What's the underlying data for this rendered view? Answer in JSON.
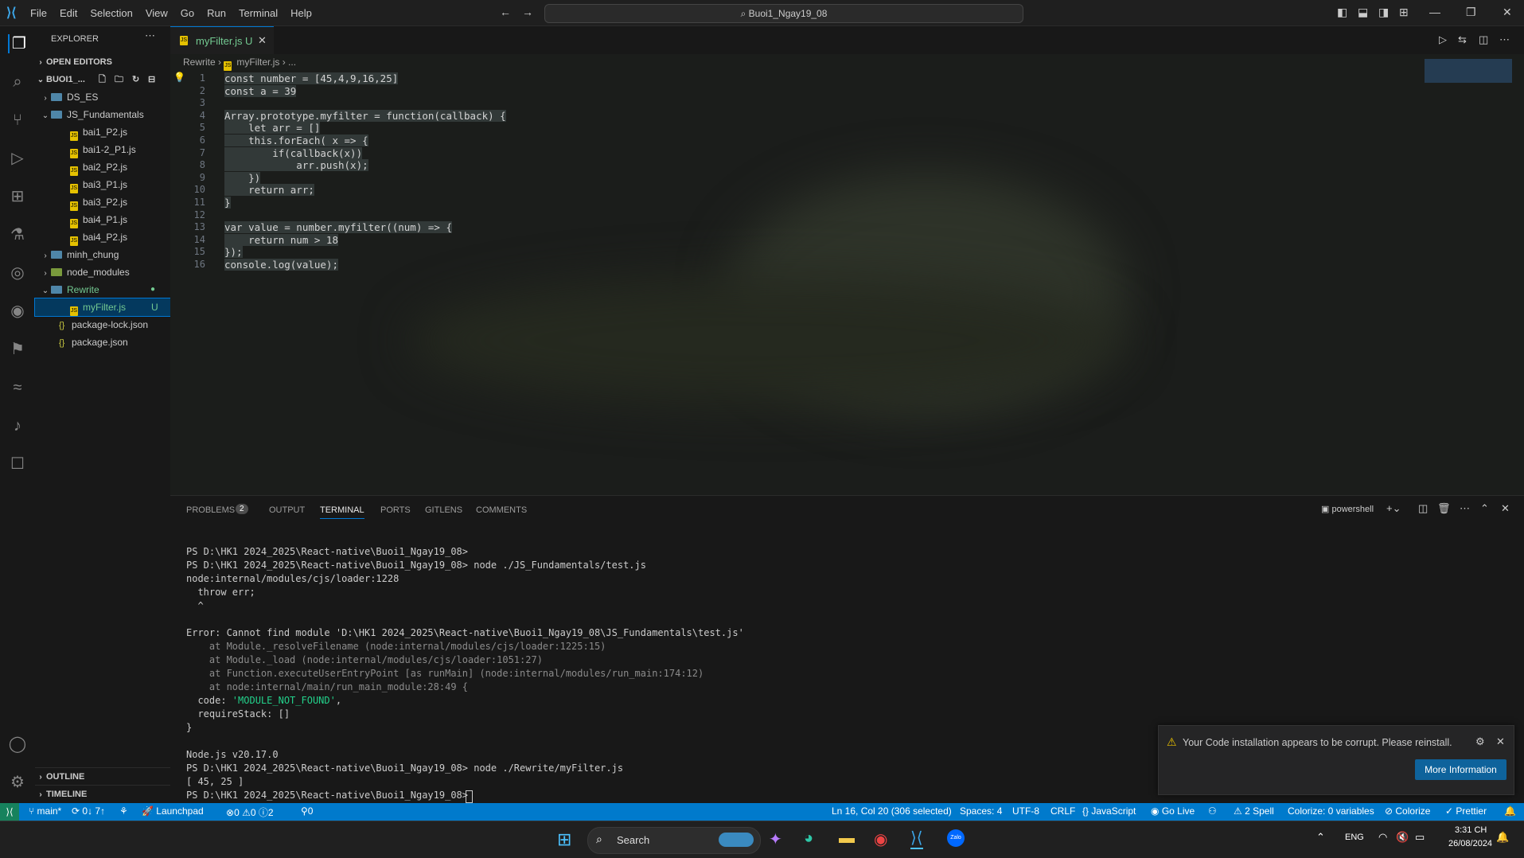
{
  "menu": [
    "File",
    "Edit",
    "Selection",
    "View",
    "Go",
    "Run",
    "Terminal",
    "Help"
  ],
  "command_center": "Buoi1_Ngay19_08",
  "explorer": {
    "title": "EXPLORER",
    "open_editors": "OPEN EDITORS",
    "workspace": "BUOI1_...",
    "items": [
      {
        "label": "DS_ES",
        "type": "folder",
        "depth": 1
      },
      {
        "label": "JS_Fundamentals",
        "type": "folder-open",
        "depth": 1
      },
      {
        "label": "bai1_P2.js",
        "type": "js",
        "depth": 2
      },
      {
        "label": "bai1-2_P1.js",
        "type": "js",
        "depth": 2
      },
      {
        "label": "bai2_P2.js",
        "type": "js",
        "depth": 2
      },
      {
        "label": "bai3_P1.js",
        "type": "js",
        "depth": 2
      },
      {
        "label": "bai3_P2.js",
        "type": "js",
        "depth": 2
      },
      {
        "label": "bai4_P1.js",
        "type": "js",
        "depth": 2
      },
      {
        "label": "bai4_P2.js",
        "type": "js",
        "depth": 2
      },
      {
        "label": "minh_chung",
        "type": "folder",
        "depth": 1
      },
      {
        "label": "node_modules",
        "type": "folder",
        "depth": 1
      },
      {
        "label": "Rewrite",
        "type": "folder-open",
        "depth": 1
      },
      {
        "label": "myFilter.js",
        "type": "js",
        "depth": 2,
        "badge": "U"
      },
      {
        "label": "package-lock.json",
        "type": "json",
        "depth": 1
      },
      {
        "label": "package.json",
        "type": "json",
        "depth": 1
      }
    ],
    "outline": "OUTLINE",
    "timeline": "TIMELINE"
  },
  "tab": {
    "name": "myFilter.js",
    "status": "U"
  },
  "breadcrumb": {
    "folder": "Rewrite",
    "file": "myFilter.js",
    "rest": "..."
  },
  "code_lines": [
    "const number = [45,4,9,16,25]",
    "const a = 39",
    "",
    "Array.prototype.myfilter = function(callback) {",
    "    let arr = []",
    "    this.forEach( x => {",
    "        if(callback(x))",
    "            arr.push(x);",
    "    })",
    "    return arr;",
    "}",
    "",
    "var value = number.myfilter((num) => {",
    "    return num > 18",
    "});",
    "console.log(value);"
  ],
  "panel": {
    "tabs": [
      "PROBLEMS",
      "OUTPUT",
      "TERMINAL",
      "PORTS",
      "GITLENS",
      "COMMENTS"
    ],
    "problems_count": "2",
    "shell": "powershell",
    "terminal_lines": [
      "PS D:\\HK1 2024_2025\\React-native\\Buoi1_Ngay19_08>",
      "PS D:\\HK1 2024_2025\\React-native\\Buoi1_Ngay19_08> node ./JS_Fundamentals/test.js",
      "node:internal/modules/cjs/loader:1228",
      "  throw err;",
      "  ^",
      "",
      "Error: Cannot find module 'D:\\HK1 2024_2025\\React-native\\Buoi1_Ngay19_08\\JS_Fundamentals\\test.js'",
      "    at Module._resolveFilename (node:internal/modules/cjs/loader:1225:15)",
      "    at Module._load (node:internal/modules/cjs/loader:1051:27)",
      "    at Function.executeUserEntryPoint [as runMain] (node:internal/modules/run_main:174:12)",
      "    at node:internal/main/run_main_module:28:49 {",
      "  code: 'MODULE_NOT_FOUND',",
      "  requireStack: []",
      "}",
      "",
      "Node.js v20.17.0",
      "PS D:\\HK1 2024_2025\\React-native\\Buoi1_Ngay19_08> node ./Rewrite/myFilter.js",
      "[ 45, 25 ]",
      "PS D:\\HK1 2024_2025\\React-native\\Buoi1_Ngay19_08> "
    ]
  },
  "notification": {
    "message": "Your Code installation appears to be corrupt. Please reinstall.",
    "button": "More Information"
  },
  "status": {
    "branch": "main*",
    "sync": "0↓ 7↑",
    "launchpad": "Launchpad",
    "errors": "0",
    "warnings": "0",
    "info": "2",
    "ports": "0",
    "position": "Ln 16, Col 20 (306 selected)",
    "spaces": "Spaces: 4",
    "encoding": "UTF-8",
    "eol": "CRLF",
    "language": "JavaScript",
    "golive": "Go Live",
    "spell": "2 Spell",
    "colorize_vars": "Colorize: 0 variables",
    "colorize": "Colorize",
    "prettier": "Prettier"
  },
  "taskbar": {
    "search": "Search",
    "lang": "ENG",
    "time": "3:31 CH",
    "date": "26/08/2024"
  },
  "colors": {
    "accent": "#007acc",
    "button": "#0e639c"
  }
}
